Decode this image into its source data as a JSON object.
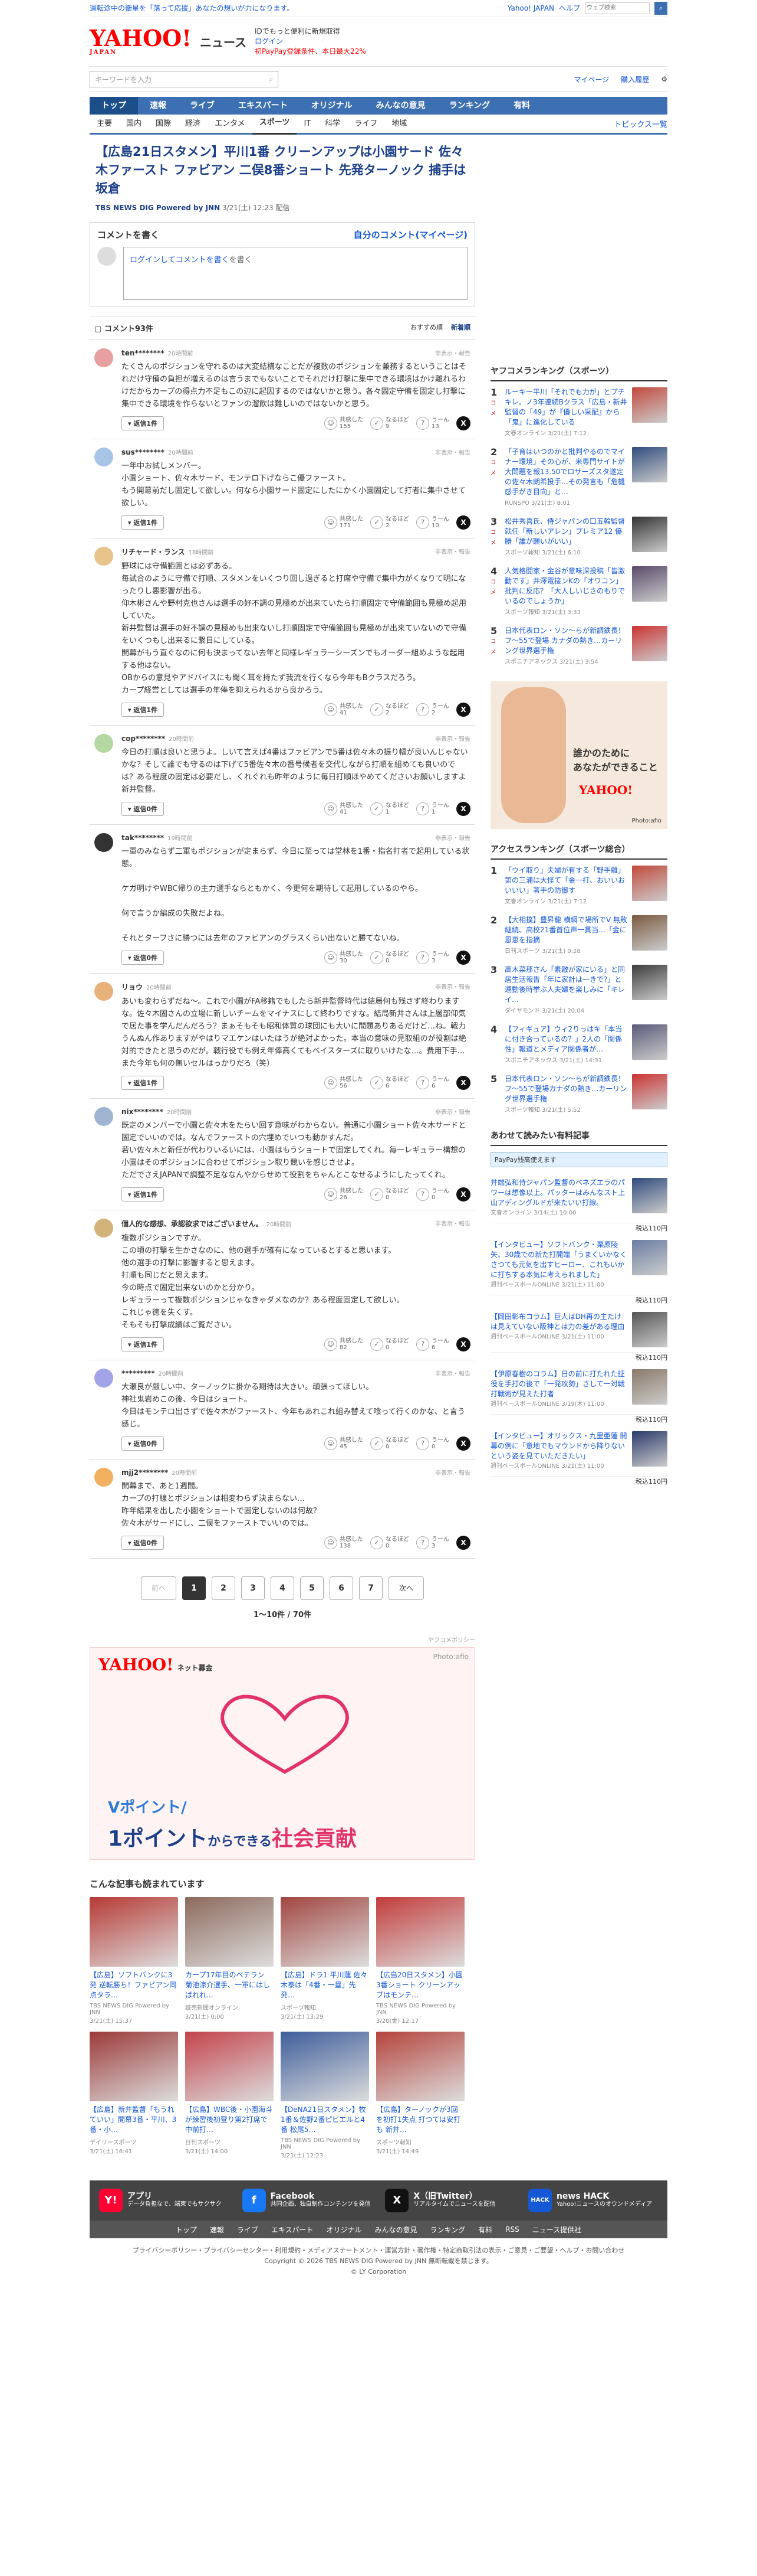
{
  "topbar": {
    "announcement": "運転途中の衛星を「落って応援」あなたの想いが力になります。",
    "yahoo_japan": "Yahoo! JAPAN",
    "help": "ヘルプ",
    "search_placeholder": "ウェブ検索"
  },
  "header": {
    "logo_text": "YAHOO!",
    "logo_sub": "JAPAN",
    "service_name": "ニュース",
    "promo_line1": "IDでもっと便利に新規取得",
    "promo_login": "ログイン",
    "promo_line2": "初PayPay登録条件、本日最大22%"
  },
  "search": {
    "placeholder": "キーワードを入力",
    "mypage": "マイページ",
    "subscribe": "購入履歴"
  },
  "global_nav": [
    "トップ",
    "速報",
    "ライブ",
    "エキスパート",
    "オリジナル",
    "みんなの意見",
    "ランキング",
    "有料"
  ],
  "sub_nav": [
    "主要",
    "国内",
    "国際",
    "経済",
    "エンタメ",
    "スポーツ",
    "IT",
    "科学",
    "ライフ",
    "地域"
  ],
  "sub_nav_topics": "トピックス一覧",
  "article": {
    "title": "【広島21日スタメン】平川1番 クリーンアップは小園サード 佐々木ファースト ファビアン 二俣8番ショート 先発ターノック 捕手は坂倉",
    "source": "TBS NEWS DIG Powered by JNN",
    "date": "3/21(土) 12:23 配信"
  },
  "comment_form": {
    "heading": "コメントを書く",
    "my_comments": "自分のコメント(マイページ)",
    "placeholder": "ログインしてコメントを書く"
  },
  "comment_list": {
    "count_label": "コメント93件",
    "sort_recommend": "おすすめ順",
    "sort_new": "新着順"
  },
  "comments": [
    {
      "name": "ten********",
      "time": "20時間前",
      "report": "非表示・報告",
      "text": "たくさんのポジションを守れるのは大変結構なことだが複数のポジションを兼務するということはそれだけ守備の負担が増えるのは言うまでもないことでそれだけ打撃に集中できる環境はかけ離れるわけだからカープの得点力不足もこの辺に起因するのではないかと思う。各々固定守備を固定し打撃に集中できる環境を作らないとファンの溜飲は難しいのではないかと思う。",
      "replies": "返信1件",
      "agree": "155",
      "nannaru": "9",
      "unsure": "13"
    },
    {
      "name": "sus********",
      "time": "20時間前",
      "report": "非表示・報告",
      "text": "一年中お試しメンバー。\n小園ショート、佐々木サード、モンテロ下げならこ優ファースト。\nもう開幕前だし固定して欲しい。何なら小園サード固定にしたにかく小園固定して打者に集中させて欲しい。",
      "replies": "返信1件",
      "agree": "171",
      "nannaru": "2",
      "unsure": "10"
    },
    {
      "name": "リチャード・ランス",
      "time": "18時間前",
      "report": "非表示・報告",
      "text": "野球には守備範囲とは必ずある。\n毎試合のように守備で打順、スタメンをいくつり回し過ぎると打席や守備で集中力がくなりて明になったりし悪影響が出る。\n仰木彬さんや野村克也さんは選手の好不調の見極めが出来ていたら打順固定で守備範囲も見極め起用していた。\n新井監督は選手の好不調の見極めも出来ないし打順固定で守備範囲も見極めが出来ていないので守備をいくつもし出来るに繋目にしている。\n開幕がもう直ぐなのに何も決まってない去年と同様レギュラーシーズンでもオーダー組めような起用する他はない。\nOBからの意見やアドバイスにも聞く耳を持たず我流を行くなら今年もBクラスだろう。\nカープ経営としては選手の年俸を抑えられるから良かろう。",
      "replies": "返信1件",
      "agree": "41",
      "nannaru": "2",
      "unsure": "2"
    },
    {
      "name": "cop********",
      "time": "20時間前",
      "report": "非表示・報告",
      "text": "今日の打順は良いと思うよ。しいて言えば4番はファビアンで5番は佐々木の振り幅が良いんじゃないかな？そして誰でも守るのは下げて5番佐々木の番号候者を交代しながら打順を組めても良いのでは？ある程度の固定は必要だし、くれぐれも昨年のように毎日打順ほやめてくださいお願いしますよ新井監督。",
      "replies": "返信0件",
      "agree": "41",
      "nannaru": "1",
      "unsure": "1"
    },
    {
      "name": "tak********",
      "time": "19時間前",
      "report": "非表示・報告",
      "text": "一軍のみならず二軍もポジションが定まらず、今日に至っては堂林を1番・指名打者で起用している状態。\n\nケガ明けやWBC帰りの主力選手ならともかく、今更何を期待して起用しているのやら。\n\n何で言うか編成の失敗だよね。\n\nそれとターフさに勝つには去年のファビアンのグラスくらい出ないと勝てないね。",
      "replies": "返信0件",
      "agree": "30",
      "nannaru": "0",
      "unsure": "3"
    },
    {
      "name": "リョウ",
      "time": "20時間前",
      "report": "非表示・報告",
      "text": "あいも変わらずだね〜。これで小園がFA移籍でもしたら新井監督時代は結局何も残さず終わりますな。佐々木固さんの立場に新しいチームをマイナスにして終わりですな。結局新井さんは上層部仰気で居た事を学んだんだろう？まぁそもそも昭和体質の球団にも大いに問題ありあるだけど…ね。戦力うんぬん作ありますがやはりマエケンはいたはうが絶対よかった。本当の意味の見取組のが役割は絶対的できたと思うのだが。戦行役でも例え年俸高くてもベイスターズに取りいけたな…。费用下手…また今年も何の無いセルはっかりだろ（笑）",
      "replies": "返信1件",
      "agree": "56",
      "nannaru": "6",
      "unsure": "6"
    },
    {
      "name": "nix********",
      "time": "20時間前",
      "report": "非表示・報告",
      "text": "既定のメンバーで小園と佐々木をたらい回す意味がわからない。普通に小園ショート佐々木サードと固定でいいのでは。なんでファーストの穴埋めでいつも動かすんだ。\n若い佐々木と新任が代わりいるいには、小園はもうショートで固定してくれ。毎一レギュラー構想の小園はそのポジションに合わせてポジション取り競いを感じさせよ。\nただでさえJAPANで調整不足ななんやからせめて役割をちゃんとこなせるようにしたってくれ。",
      "replies": "返信1件",
      "agree": "26",
      "nannaru": "0",
      "unsure": "0"
    },
    {
      "name": "個人的な感想、承認欲求ではございません。",
      "time": "20時間前",
      "report": "非表示・報告",
      "text": "複数ポジションですか。\nこの頃の打撃を生かさなのに、他の選手が確有になっているとすると思います。\n他の選手の打撃に影響すると思えます。\n打順も同じだと思えます。\n今の時点で固定出来ないのかと分かり。\nレギュラーって複数ポジションじゃなきゃダメなのか？ある程度固定して欲しい。\nこれじゃ徳を失くす。\nそもそも打撃成績はご覧ださい。",
      "replies": "返信1件",
      "agree": "82",
      "nannaru": "0",
      "unsure": "6"
    },
    {
      "name": "*********",
      "time": "20時間前",
      "report": "非表示・報告",
      "text": "大瀬良が厳しい中、ターノックに掛かる期待は大きい。頑張ってほしい。\n神社鬼岩めこの後、今日はショート。\n今日はモンテロ出さずで佐々木がファースト、今年もあれこれ組み替えて喰って行くのかな、と言う感じ。",
      "replies": "返信0件",
      "agree": "45",
      "nannaru": "0",
      "unsure": "0"
    },
    {
      "name": "mjj2********",
      "time": "20時間前",
      "report": "非表示・報告",
      "text": "開幕まで、あと1週間。\nカープの打線とポジションは相変わらず決まらない…\n昨年結果を出した小園をショートで固定しないのは何故？\n佐々木がサードにし、二俣をファーストでいいのでは。",
      "replies": "返信0件",
      "agree": "138",
      "nannaru": "0",
      "unsure": "3"
    }
  ],
  "reaction_labels": {
    "agree": "共感した",
    "nannaru": "なるほど",
    "unsure": "うーん"
  },
  "pagination": {
    "prev": "前へ",
    "next": "次へ",
    "pages": [
      "1",
      "2",
      "3",
      "4",
      "5",
      "6",
      "7"
    ],
    "count": "1〜10件 / 70件"
  },
  "ad": {
    "sponsor": "ヤフコメポリシー",
    "source": "Photo:afio",
    "logo": "YAHOO!",
    "logo_sub": "ネット募金",
    "line1": "Vポイント/",
    "line2_a": "1ポイント",
    "line2_b": "からできる",
    "line2_c": "社会貢献"
  },
  "recommend": {
    "heading": "こんな記事も読まれています",
    "cards": [
      {
        "title": "【広島】ソフトバンクに3発 逆転勝ち！ファビアン同点タラ…",
        "src": "TBS NEWS DIG Powered by JNN",
        "time": "3/21(土) 15:37",
        "color": "#b63a34"
      },
      {
        "title": "カープ17年目のベテラン 菊池涼介選手、一軍にはしばれれ...",
        "src": "読売新聞オンライン",
        "time": "3/21(土) 0:00",
        "color": "#8d6a5c"
      },
      {
        "title": "【広島】ドラ1 平川蓮 佐々木泰は「4番・一塁」先発…",
        "src": "スポーツ報知",
        "time": "3/21(土) 13:29",
        "color": "#a24640"
      },
      {
        "title": "【広島20日スタメン】小園3番ショート クリーンアップはモンテ…",
        "src": "TBS NEWS DIG Powered by JNN",
        "time": "3/20(金) 12:17",
        "color": "#c23c3a"
      },
      {
        "title": "【広島】新井監督「もうれていい」開幕3番・平川、3番・小…",
        "src": "デイリースポーツ",
        "time": "3/21(土) 16:41",
        "color": "#9b3a38"
      },
      {
        "title": "【広島】WBC後・小園海斗が練習後初登り第2打席で中前打…",
        "src": "日刊スポーツ",
        "time": "3/21(土) 14:00",
        "color": "#c4434b"
      },
      {
        "title": "【DeNA21日スタメン】牧1番＆佐野2番ピビエルと4番 松尾5…",
        "src": "TBS NEWS DIG Powered by JNN",
        "time": "3/21(土) 12:23",
        "color": "#3d5d9b"
      },
      {
        "title": "【広島】ターノックが3回を初打1失点 打つては安打も 新井…",
        "src": "スポーツ報知",
        "time": "3/21(土) 14:49",
        "color": "#b5443c"
      }
    ]
  },
  "sidebar": {
    "ranking_heading": "ヤフコメランキング（スポーツ）",
    "ranking": [
      {
        "no": "1",
        "badge": "コメ",
        "title": "ルーキー平川「それでも力が」とプチキレ。ノ3年連続Bクラス「広島・新井監督の「49」が『優しい采配』から「鬼」に進化している",
        "src": "文春オンライン 3/21(土) 7:12",
        "color": "#c24a3c"
      },
      {
        "no": "2",
        "badge": "コメ",
        "title": "「子育はいつのかと批判やるのでマイナー環境」その心が、米専門サイトが大問題を報13.50でロサーズスタ遂定の佐々木朗希投手…その発言も「危機感手がき目向」と…",
        "src": "RUNSPO 3/21(土) 8:01",
        "color": "#2f4b7c"
      },
      {
        "no": "3",
        "badge": "コメ",
        "title": "松井秀喜氏、侍ジャパンの口五輪監督就任「新しいアレン」プレミア12 優勝「誰が願いがいい」",
        "src": "スポーツ報知 3/21(土) 6:10",
        "color": "#333"
      },
      {
        "no": "4",
        "badge": "コメ",
        "title": "人気格闘家・金谷が意味深投稿「皆激動です」井澤電接ンKの「オワコン」批判に反応？「大人しいじさのもりでいるのでしょうか」",
        "src": "スポーツ報知 3/21(土) 3:33",
        "color": "#5a4a6a"
      },
      {
        "no": "5",
        "badge": "コメ",
        "title": "日本代表ロン・ソン〜らが新調鉄長！フ〜55で登場 カナダの熱き…カーリング世界選手権",
        "src": "スポニチアネックス 3/21(土) 3:54",
        "color": "#c33"
      }
    ],
    "ad_text1": "誰かのために",
    "ad_text2": "あなたができること",
    "ad_logo": "YAHOO!",
    "ad_src": "Photo:afio",
    "access_heading": "アクセスランキング（スポーツ総合）",
    "access": [
      {
        "no": "1",
        "title": "「ウイ取り」夫婦が有する「野手離」第の三浦は大怪て「金一打、おいいおいいい」著手の防御す",
        "src": "文春オンライン 3/21(土) 7:12",
        "color": "#c24a3c"
      },
      {
        "no": "2",
        "title": "【大相撲】豊昇龍 横綱で場所でV 無敗継続、高校21番首位声一貫当...「金に恩恵を指摘",
        "src": "日刊スポーツ 3/21(土) 0:28",
        "color": "#7a5a40"
      },
      {
        "no": "3",
        "title": "高木菜那さん「素敵が家にいる」と同居生活報告「年に家計は一きで?」と運動後時挙ぶ人夫婦を楽しみに「キレイ...",
        "src": "ダイヤモンド 3/21(土) 20:04",
        "color": "#3c3c3c"
      },
      {
        "no": "4",
        "title": "【フィギュア】ウィ2りっはキ「本当に付き合っているの？」2人の「関係性」報道とメディア関係者が…",
        "src": "スポニチアネックス 3/21(土) 14:31",
        "color": "#5a5a7a"
      },
      {
        "no": "5",
        "title": "日本代表ロン・ソン〜らが新調鉄長！フ〜55で登場カナダの熱き…カーリング世界選手権",
        "src": "スポーツ報知 3/21(土) 5:52",
        "color": "#c33"
      }
    ],
    "shop_heading": "あわせて読みたい有料記事",
    "paypay": "PayPay残高使えます",
    "shop": [
      {
        "title": "井端弘和侍ジャパン監督のベネズエラのパワーは想像以上。パッターはみんなスト上山アディングルドが来たいい打線。",
        "src": "文春オンライン 3/14(土) 10:00",
        "price": "税込110円",
        "color": "#2f4b7c"
      },
      {
        "title": "【インタビュー】ソフトバンク・栗原陵矢、30歳での新た打開端「うまくいかなくさつても元気を出すヒーロー、これもいかに打ちする本気に考えられました」",
        "src": "週刊ベースボールONLINE 3/21(土) 11:00",
        "price": "税込110円",
        "color": "#6b7da3"
      },
      {
        "title": "【岡田彰布コラム】巨人はDH再の主たけは見えていない阪神とは力の差がある理由",
        "src": "週刊ベースボールONLINE 3/21(土) 11:00",
        "price": "税込110円",
        "color": "#555"
      },
      {
        "title": "【伊原春樹のコラム】日の前に打たれた証役を手打の後で「一発攻勢」さして一対戦打戦術が見えた打者",
        "src": "週刊ベースボールONLINE 3/19(木) 11:00",
        "price": "税込110円",
        "color": "#8a7a6a"
      },
      {
        "title": "【インタビュー】オリックス・九里亜蓮 開幕の例に「意地でもマウンドから降りないという姿を見ていただきたい」",
        "src": "週刊ベースボールONLINE 3/21(土) 11:00",
        "price": "税込110円",
        "color": "#2a3a6a"
      }
    ]
  },
  "footer": {
    "apps": [
      {
        "icon": "Y!",
        "name": "アプリ",
        "desc": "データ負担なで、端束でもサクサク",
        "color": "#f03"
      },
      {
        "icon": "f",
        "name": "Facebook",
        "desc": "共同企画、独自制作コンテンツを発信",
        "color": "#1877f2"
      },
      {
        "icon": "X",
        "name": "X（旧Twitter）",
        "desc": "リアルタイムでニュースを配信",
        "color": "#111"
      },
      {
        "icon": "HACK",
        "name": "news HACK",
        "desc": "Yahoo!ニュースのオウンドメディア",
        "color": "#1558d6"
      }
    ],
    "nav": [
      "トップ",
      "速報",
      "ライブ",
      "エキスパート",
      "オリジナル",
      "みんなの意見",
      "ランキング",
      "有料",
      "RSS",
      "ニュース提供社"
    ],
    "links": "プライバシーポリシー・プライバシーセンター・利用規約・メディアステートメント・運営方針・著作権・特定商取引法の表示・ご意見・ご要望・ヘルプ・お問い合わせ",
    "copyright1": "Copyright © 2026 TBS NEWS DIG Powered by JNN 無断転載を禁じます。",
    "copyright2": "© LY Corporation"
  }
}
